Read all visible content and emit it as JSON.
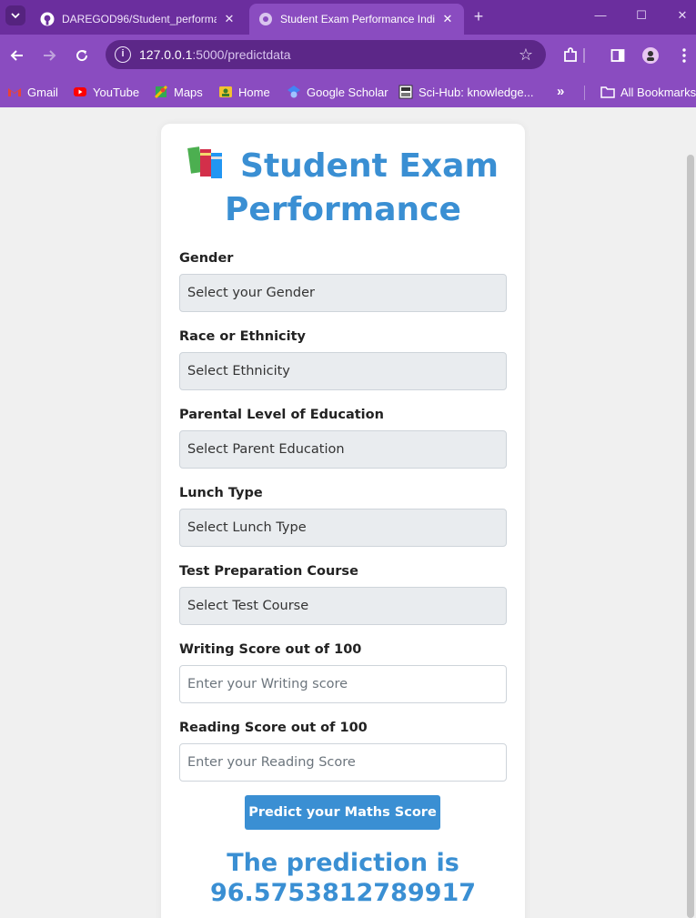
{
  "browser": {
    "tabs": [
      {
        "title": "DAREGOD96/Student_performa",
        "active": false,
        "icon": "github-icon"
      },
      {
        "title": "Student Exam Performance Indi",
        "active": true,
        "icon": "globe-icon"
      }
    ],
    "url_host": "127.0.0.1",
    "url_path": ":5000/predictdata",
    "bookmarks": [
      {
        "label": "Gmail",
        "icon": "gmail-icon"
      },
      {
        "label": "YouTube",
        "icon": "youtube-icon"
      },
      {
        "label": "Maps",
        "icon": "maps-icon"
      },
      {
        "label": "Home",
        "icon": "home-icon"
      },
      {
        "label": "Google Scholar",
        "icon": "scholar-icon"
      },
      {
        "label": "Sci-Hub: knowledge...",
        "icon": "scihub-icon"
      }
    ],
    "more_bookmarks": "»",
    "all_bookmarks": "All Bookmarks",
    "colors": {
      "frame": "#6b2e9e",
      "toolbar": "#8a4cc0"
    }
  },
  "page": {
    "title_line1": "Student Exam",
    "title_line2": "Performance",
    "fields": [
      {
        "label": "Gender",
        "type": "select",
        "value": "Select your Gender"
      },
      {
        "label": "Race or Ethnicity",
        "type": "select",
        "value": "Select Ethnicity"
      },
      {
        "label": "Parental Level of Education",
        "type": "select",
        "value": "Select Parent Education"
      },
      {
        "label": "Lunch Type",
        "type": "select",
        "value": "Select Lunch Type"
      },
      {
        "label": "Test Preparation Course",
        "type": "select",
        "value": "Select Test Course"
      },
      {
        "label": "Writing Score out of 100",
        "type": "input",
        "placeholder": "Enter your Writing score"
      },
      {
        "label": "Reading Score out of 100",
        "type": "input",
        "placeholder": "Enter your Reading Score"
      }
    ],
    "submit_label": "Predict your Maths Score",
    "result_line1": "The prediction is",
    "result_value": "96.5753812789917",
    "colors": {
      "accent": "#3a8fd3",
      "select_bg": "#e9ecef"
    }
  }
}
